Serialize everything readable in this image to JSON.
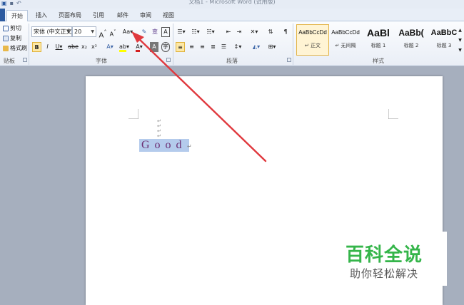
{
  "window": {
    "title": "文档1 - Microsoft Word (试用版)"
  },
  "tabs": [
    {
      "label": "开始",
      "active": true
    },
    {
      "label": "插入",
      "active": false
    },
    {
      "label": "页面布局",
      "active": false
    },
    {
      "label": "引用",
      "active": false
    },
    {
      "label": "邮件",
      "active": false
    },
    {
      "label": "审阅",
      "active": false
    },
    {
      "label": "视图",
      "active": false
    }
  ],
  "clipboard": {
    "cut": "剪切",
    "copy": "复制",
    "format_painter": "格式刷",
    "group_label": "贴板"
  },
  "font": {
    "name": "宋体 (中文正文)",
    "size": "20",
    "grow": "A",
    "shrink": "A",
    "change_case": "Aa",
    "bold": "B",
    "italic": "I",
    "underline": "U",
    "strikethrough": "abe",
    "subscript": "x₂",
    "superscript": "x²",
    "highlight_color": "#ffff00",
    "font_color": "#d42020",
    "group_label": "字体"
  },
  "paragraph": {
    "group_label": "段落"
  },
  "styles": {
    "items": [
      {
        "sample": "AaBbCcDd",
        "name": "↵ 正文",
        "selected": true
      },
      {
        "sample": "AaBbCcDd",
        "name": "↵ 无间隔",
        "selected": false
      },
      {
        "sample": "AaBl",
        "name": "标题 1",
        "selected": false
      },
      {
        "sample": "AaBb(",
        "name": "标题 2",
        "selected": false
      },
      {
        "sample": "AaBbC",
        "name": "标题 3",
        "selected": false
      }
    ],
    "group_label": "样式"
  },
  "document": {
    "text": "Good",
    "paragraph_mark": "↵",
    "selection_color": "#b4cbec",
    "text_color": "#6b2e72"
  },
  "annotation": {
    "arrow_color": "#e0393e"
  },
  "watermark": {
    "title": "百科全说",
    "subtitle": "助你轻松解决",
    "title_color": "#35b54a"
  }
}
